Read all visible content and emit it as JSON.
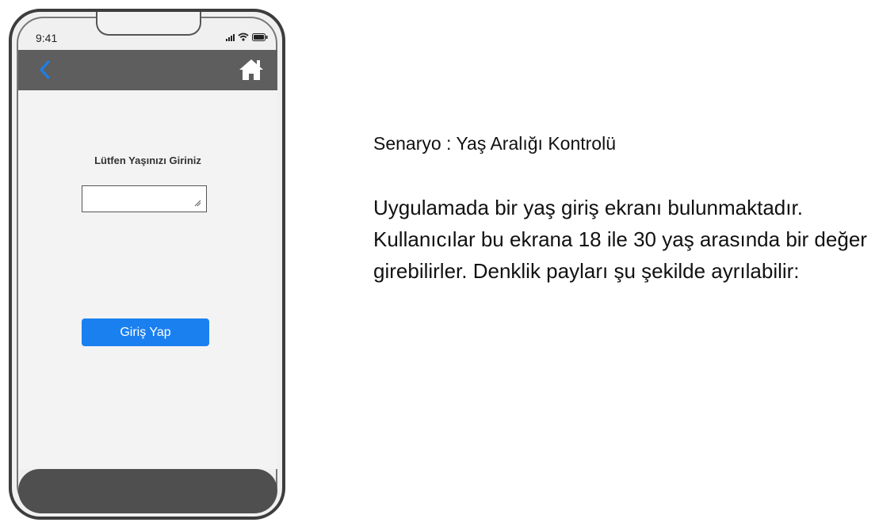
{
  "phone": {
    "status": {
      "time": "9:41"
    },
    "navbar": {
      "back_icon": "chevron-left-icon",
      "home_icon": "home-icon",
      "accent": "#1a80f0"
    },
    "form": {
      "prompt_label": "Lütfen Yaşınızı Giriniz",
      "age_input_value": "",
      "submit_label": "Giriş Yap"
    }
  },
  "description": {
    "title": "Senaryo : Yaş Aralığı Kontrolü",
    "body": "Uygulamada bir yaş giriş ekranı bulunmaktadır. Kullanıcılar bu ekrana 18 ile 30 yaş arasında bir değer girebilirler. Denklik payları şu şekilde ayrılabilir:"
  }
}
